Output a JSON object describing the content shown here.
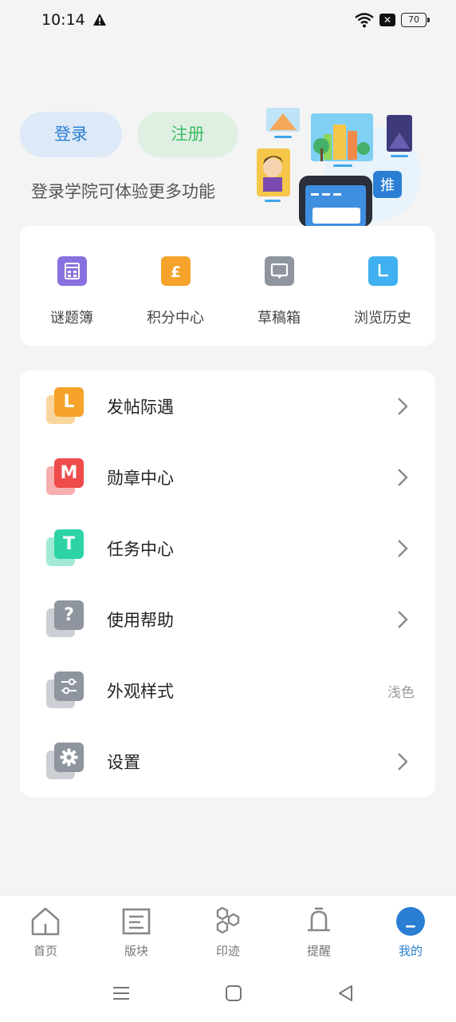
{
  "status_bar": {
    "time": "10:14",
    "battery": "70"
  },
  "auth": {
    "login_label": "登录",
    "register_label": "注册",
    "promo_text": "登录学院可体验更多功能",
    "illustration_badge": "推"
  },
  "quick_actions": [
    {
      "label": "谜题簿",
      "icon": "puzzle-book-icon",
      "color": "#8a6fe0"
    },
    {
      "label": "积分中心",
      "icon": "points-icon",
      "color": "#f5a32a"
    },
    {
      "label": "草稿箱",
      "icon": "drafts-icon",
      "color": "#8e959e"
    },
    {
      "label": "浏览历史",
      "icon": "history-icon",
      "color": "#3fb0f0"
    }
  ],
  "menu": [
    {
      "label": "发帖际遇",
      "glyph": "L",
      "icon": "post-encounter-icon",
      "color": "#f5a32a",
      "value": ""
    },
    {
      "label": "勋章中心",
      "glyph": "M",
      "icon": "medal-icon",
      "color": "#ee4b4b",
      "value": ""
    },
    {
      "label": "任务中心",
      "glyph": "T",
      "icon": "task-icon",
      "color": "#2ed3a5",
      "value": ""
    },
    {
      "label": "使用帮助",
      "glyph": "?",
      "icon": "help-icon",
      "color": "#8e959e",
      "value": ""
    },
    {
      "label": "外观样式",
      "glyph": "",
      "icon": "appearance-icon",
      "color": "#8e959e",
      "value": "浅色"
    },
    {
      "label": "设置",
      "glyph": "",
      "icon": "settings-icon",
      "color": "#8e959e",
      "value": ""
    }
  ],
  "bottom_nav": [
    {
      "label": "首页",
      "icon": "home-icon",
      "active": false
    },
    {
      "label": "版块",
      "icon": "sections-icon",
      "active": false
    },
    {
      "label": "印迹",
      "icon": "footprint-icon",
      "active": false
    },
    {
      "label": "提醒",
      "icon": "bell-icon",
      "active": false
    },
    {
      "label": "我的",
      "icon": "profile-icon",
      "active": true
    }
  ],
  "colors": {
    "accent": "#2a7fd4",
    "register_green": "#3dbb66"
  }
}
